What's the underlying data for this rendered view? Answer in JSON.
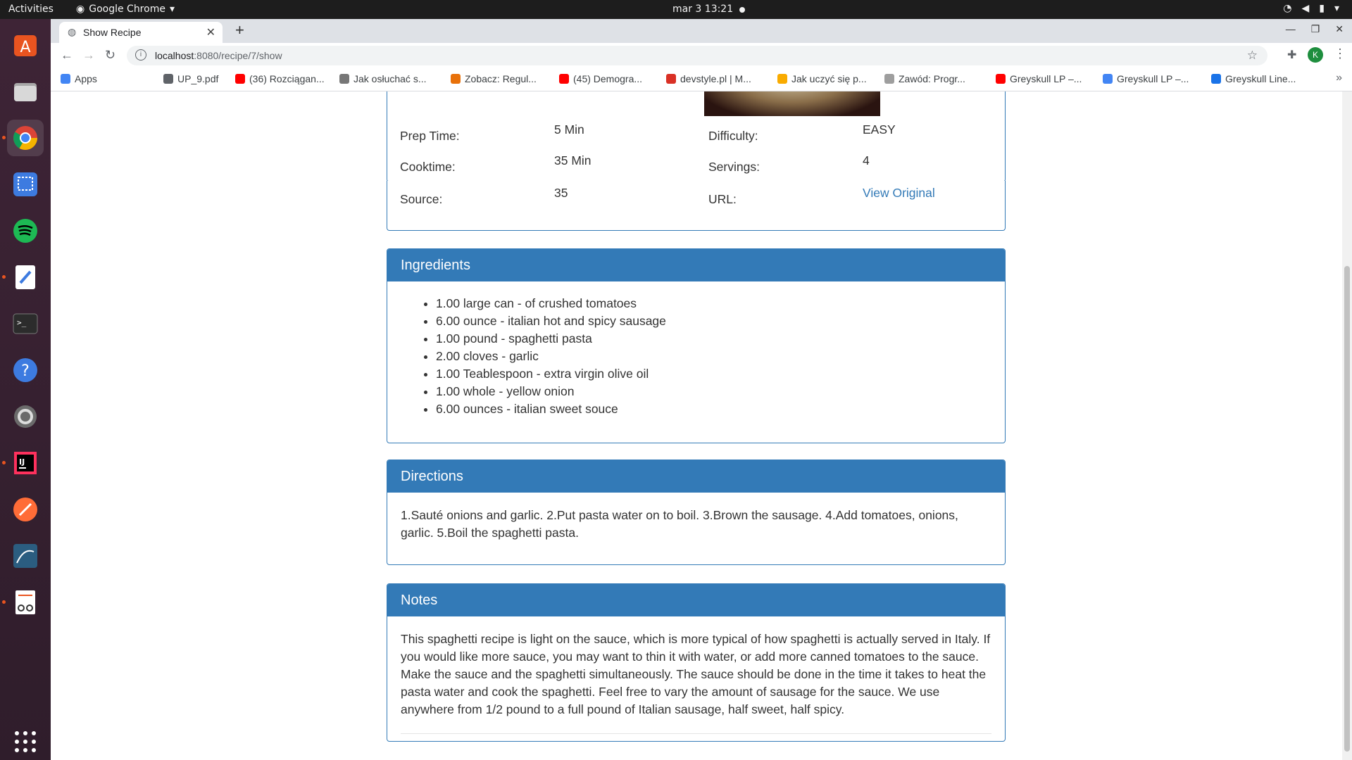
{
  "topbar": {
    "activities": "Activities",
    "app_name": "Google Chrome",
    "clock": "mar 3  13:21"
  },
  "browser": {
    "tab_title": "Show Recipe",
    "url_host": "localhost",
    "url_rest": ":8080/recipe/7/show",
    "avatar_letter": "K",
    "bookmarks": [
      {
        "label": "Apps",
        "color": "#4285f4"
      },
      {
        "label": "UP_9.pdf",
        "color": "#5f6368"
      },
      {
        "label": "(36) Rozciągan...",
        "color": "#ff0000"
      },
      {
        "label": "Jak osłuchać s...",
        "color": "#777777"
      },
      {
        "label": "Zobacz: Regul...",
        "color": "#e8710a"
      },
      {
        "label": "(45) Demogra...",
        "color": "#ff0000"
      },
      {
        "label": "devstyle.pl | M...",
        "color": "#d93025"
      },
      {
        "label": "Jak uczyć się p...",
        "color": "#f9ab00"
      },
      {
        "label": "Zawód: Progr...",
        "color": "#9e9e9e"
      },
      {
        "label": "Greyskull LP –...",
        "color": "#ff0000"
      },
      {
        "label": "Greyskull LP –...",
        "color": "#4285f4"
      },
      {
        "label": "Greyskull Line...",
        "color": "#1a73e8"
      }
    ]
  },
  "recipe": {
    "prep_label": "Prep Time:",
    "prep_value": "5 Min",
    "difficulty_label": "Difficulty:",
    "difficulty_value": "EASY",
    "cook_label": "Cooktime:",
    "cook_value": "35 Min",
    "servings_label": "Servings:",
    "servings_value": "4",
    "source_label": "Source:",
    "source_value": "35",
    "url_label": "URL:",
    "url_link": "View Original"
  },
  "ingredients": {
    "title": "Ingredients",
    "items": [
      "1.00 large can - of crushed tomatoes",
      "6.00 ounce - italian hot and spicy sausage",
      "1.00 pound - spaghetti pasta",
      "2.00 cloves - garlic",
      "1.00 Teablespoon - extra virgin olive oil",
      "1.00 whole - yellow onion",
      "6.00 ounces - italian sweet souce"
    ]
  },
  "directions": {
    "title": "Directions",
    "text": "1.Sauté onions and garlic. 2.Put pasta water on to boil. 3.Brown the sausage. 4.Add tomatoes, onions, garlic. 5.Boil the spaghetti pasta."
  },
  "notes": {
    "title": "Notes",
    "text": "This spaghetti recipe is light on the sauce, which is more typical of how spaghetti is actually served in Italy. If you would like more sauce, you may want to thin it with water, or add more canned tomatoes to the sauce. Make the sauce and the spaghetti simultaneously. The sauce should be done in the time it takes to heat the pasta water and cook the spaghetti. Feel free to vary the amount of sausage for the sauce. We use anywhere from 1/2 pound to a full pound of Italian sausage, half sweet, half spicy."
  }
}
